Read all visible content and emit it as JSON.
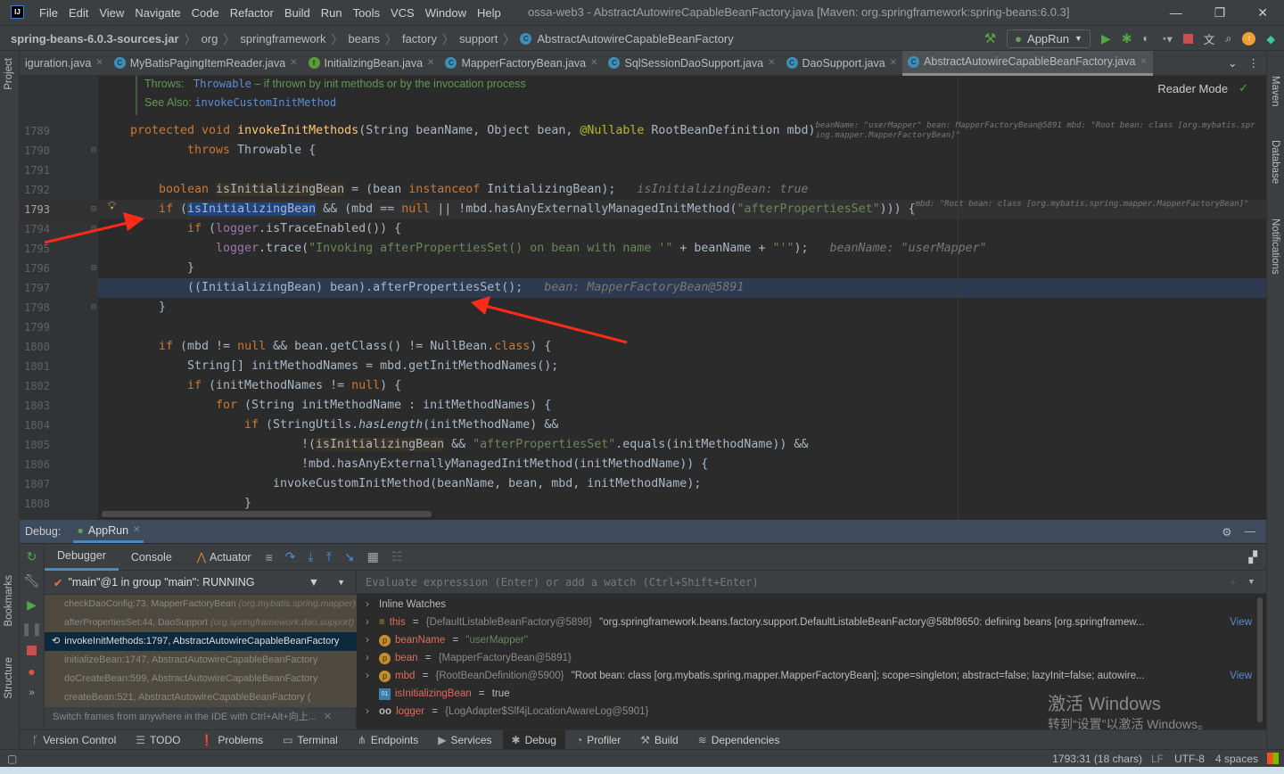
{
  "app": {
    "logo": "IJ",
    "menu": [
      "File",
      "Edit",
      "View",
      "Navigate",
      "Code",
      "Refactor",
      "Build",
      "Run",
      "Tools",
      "VCS",
      "Window",
      "Help"
    ],
    "title": "ossa-web3 - AbstractAutowireCapableBeanFactory.java [Maven: org.springframework:spring-beans:6.0.3]"
  },
  "breadcrumbs": [
    "spring-beans-6.0.3-sources.jar",
    "org",
    "springframework",
    "beans",
    "factory",
    "support",
    "AbstractAutowireCapableBeanFactory"
  ],
  "toolbar": {
    "run_config": "AppRun"
  },
  "tabs": [
    {
      "label": "iguration.java",
      "icon": "class",
      "active": false
    },
    {
      "label": "MyBatisPagingItemReader.java",
      "icon": "class",
      "active": false
    },
    {
      "label": "InitializingBean.java",
      "icon": "interface",
      "active": false
    },
    {
      "label": "MapperFactoryBean.java",
      "icon": "class",
      "active": false
    },
    {
      "label": "SqlSessionDaoSupport.java",
      "icon": "class",
      "active": false
    },
    {
      "label": "DaoSupport.java",
      "icon": "class",
      "active": false
    },
    {
      "label": "AbstractAutowireCapableBeanFactory.java",
      "icon": "class",
      "active": true
    }
  ],
  "side_left": [
    "Project",
    "Bookmarks",
    "Structure"
  ],
  "side_right": [
    "Maven",
    "Database",
    "Notifications"
  ],
  "editor": {
    "reader_mode": "Reader Mode",
    "doc": {
      "throws_label": "Throws:",
      "throws_type": "Throwable",
      "throws_text": " – if thrown by init methods or by the invocation process",
      "see_label": "See Also:",
      "see_link": "invokeCustomInitMethod"
    },
    "lines": [
      {
        "n": "1789",
        "indent": 0,
        "tokens": [
          {
            "t": "kw",
            "s": "protected void "
          },
          {
            "t": "fn",
            "s": "invokeInitMethods"
          },
          {
            "t": "p",
            "s": "(String beanName, Object bean, "
          },
          {
            "t": "ann",
            "s": "@Nullable"
          },
          {
            "t": "p",
            "s": " RootBeanDefinition mbd)"
          },
          {
            "t": "hint",
            "s": "   beanName: \"userMapper\"    bean: MapperFactoryBean@5891    mbd: \"Root bean: class [org.mybatis.spring.mapper.MapperFactoryBean]\""
          }
        ]
      },
      {
        "n": "1790",
        "indent": 8,
        "tokens": [
          {
            "t": "kw",
            "s": "throws"
          },
          {
            "t": "p",
            "s": " Throwable {"
          }
        ]
      },
      {
        "n": "1791",
        "indent": 0,
        "tokens": []
      },
      {
        "n": "1792",
        "indent": 4,
        "tokens": [
          {
            "t": "kw",
            "s": "boolean "
          },
          {
            "t": "var",
            "s": "isInitializingBean"
          },
          {
            "t": "p",
            "s": " = (bean "
          },
          {
            "t": "kw",
            "s": "instanceof"
          },
          {
            "t": "p",
            "s": " InitializingBean);"
          },
          {
            "t": "hint",
            "s": "   isInitializingBean: true"
          }
        ]
      },
      {
        "n": "1793",
        "indent": 4,
        "current": true,
        "tokens": [
          {
            "t": "kw",
            "s": "if"
          },
          {
            "t": "p",
            "s": " ("
          },
          {
            "t": "sel",
            "s": "isInitializingBean"
          },
          {
            "t": "p",
            "s": " && (mbd == "
          },
          {
            "t": "kw",
            "s": "null"
          },
          {
            "t": "p",
            "s": " || !mbd.hasAnyExternallyManagedInitMethod("
          },
          {
            "t": "str",
            "s": "\"afterPropertiesSet\""
          },
          {
            "t": "p",
            "s": "))) {"
          },
          {
            "t": "hint",
            "s": "   mbd: \"Root bean: class [org.mybatis.spring.mapper.MapperFactoryBean]\""
          }
        ]
      },
      {
        "n": "1794",
        "indent": 8,
        "tokens": [
          {
            "t": "kw",
            "s": "if"
          },
          {
            "t": "p",
            "s": " ("
          },
          {
            "t": "field",
            "s": "logger"
          },
          {
            "t": "p",
            "s": ".isTraceEnabled()) {"
          }
        ]
      },
      {
        "n": "1795",
        "indent": 12,
        "tokens": [
          {
            "t": "field",
            "s": "logger"
          },
          {
            "t": "p",
            "s": ".trace("
          },
          {
            "t": "str",
            "s": "\"Invoking afterPropertiesSet() on bean with name '\""
          },
          {
            "t": "p",
            "s": " + beanName + "
          },
          {
            "t": "str",
            "s": "\"'\""
          },
          {
            "t": "p",
            "s": ");"
          },
          {
            "t": "hint",
            "s": "   beanName: \"userMapper\""
          }
        ]
      },
      {
        "n": "1796",
        "indent": 8,
        "tokens": [
          {
            "t": "p",
            "s": "}"
          }
        ]
      },
      {
        "n": "1797",
        "indent": 8,
        "exec": true,
        "tokens": [
          {
            "t": "p",
            "s": "((InitializingBean) bean).afterPropertiesSet();"
          },
          {
            "t": "hint",
            "s": "   bean: MapperFactoryBean@5891"
          }
        ]
      },
      {
        "n": "1798",
        "indent": 4,
        "tokens": [
          {
            "t": "p",
            "s": "}"
          }
        ]
      },
      {
        "n": "1799",
        "indent": 0,
        "tokens": []
      },
      {
        "n": "1800",
        "indent": 4,
        "tokens": [
          {
            "t": "kw",
            "s": "if"
          },
          {
            "t": "p",
            "s": " (mbd != "
          },
          {
            "t": "kw",
            "s": "null"
          },
          {
            "t": "p",
            "s": " && bean.getClass() != NullBean."
          },
          {
            "t": "kw",
            "s": "class"
          },
          {
            "t": "p",
            "s": ") {"
          }
        ]
      },
      {
        "n": "1801",
        "indent": 8,
        "tokens": [
          {
            "t": "p",
            "s": "String[] initMethodNames = mbd.getInitMethodNames();"
          }
        ]
      },
      {
        "n": "1802",
        "indent": 8,
        "tokens": [
          {
            "t": "kw",
            "s": "if"
          },
          {
            "t": "p",
            "s": " (initMethodNames != "
          },
          {
            "t": "kw",
            "s": "null"
          },
          {
            "t": "p",
            "s": ") {"
          }
        ]
      },
      {
        "n": "1803",
        "indent": 12,
        "tokens": [
          {
            "t": "kw",
            "s": "for"
          },
          {
            "t": "p",
            "s": " (String initMethodName : initMethodNames) {"
          }
        ]
      },
      {
        "n": "1804",
        "indent": 16,
        "tokens": [
          {
            "t": "kw",
            "s": "if"
          },
          {
            "t": "p",
            "s": " (StringUtils."
          },
          {
            "t": "it",
            "s": "hasLength"
          },
          {
            "t": "p",
            "s": "(initMethodName) &&"
          }
        ]
      },
      {
        "n": "1805",
        "indent": 24,
        "tokens": [
          {
            "t": "p",
            "s": "!("
          },
          {
            "t": "var",
            "s": "isInitializingBean"
          },
          {
            "t": "p",
            "s": " && "
          },
          {
            "t": "str",
            "s": "\"afterPropertiesSet\""
          },
          {
            "t": "p",
            "s": ".equals(initMethodName)) &&"
          }
        ]
      },
      {
        "n": "1806",
        "indent": 24,
        "tokens": [
          {
            "t": "p",
            "s": "!mbd.hasAnyExternallyManagedInitMethod(initMethodName)) {"
          }
        ]
      },
      {
        "n": "1807",
        "indent": 20,
        "tokens": [
          {
            "t": "p",
            "s": "invokeCustomInitMethod(beanName, bean, mbd, initMethodName);"
          }
        ]
      },
      {
        "n": "1808",
        "indent": 16,
        "tokens": [
          {
            "t": "p",
            "s": "}"
          }
        ]
      }
    ]
  },
  "debug": {
    "label": "Debug:",
    "session": "AppRun",
    "subtabs": [
      "Debugger",
      "Console",
      "Actuator"
    ],
    "thread": "\"main\"@1 in group \"main\": RUNNING",
    "frames": [
      {
        "text": "checkDaoConfig:73, MapperFactoryBean ",
        "pkg": "(org.mybatis.spring.mapper)",
        "selected": false
      },
      {
        "text": "afterPropertiesSet:44, DaoSupport ",
        "pkg": "(org.springframework.dao.support)",
        "selected": false
      },
      {
        "text": "invokeInitMethods:1797, AbstractAutowireCapableBeanFactory",
        "pkg": "",
        "selected": true
      },
      {
        "text": "initializeBean:1747, AbstractAutowireCapableBeanFactory",
        "pkg": "",
        "selected": false
      },
      {
        "text": "doCreateBean:599, AbstractAutowireCapableBeanFactory",
        "pkg": "",
        "selected": false
      },
      {
        "text": "createBean:521, AbstractAutowireCapableBeanFactory (",
        "pkg": "",
        "selected": false
      }
    ],
    "frames_hint": "Switch frames from anywhere in the IDE with Ctrl+Alt+向上...",
    "eval_placeholder": "Evaluate expression (Enter) or add a watch (Ctrl+Shift+Enter)",
    "variables": [
      {
        "icon": "none",
        "name": "",
        "eq": "",
        "val": "",
        "plain": "Inline Watches",
        "view": ""
      },
      {
        "icon": "stack",
        "name": "this",
        "eq": " = ",
        "val": "{DefaultListableBeanFactory@5898}",
        "plain": " \"org.springframework.beans.factory.support.DefaultListableBeanFactory@58bf8650: defining beans [org.springframew...",
        "view": "View"
      },
      {
        "icon": "param",
        "name": "beanName",
        "eq": " = ",
        "val": "",
        "plain": "",
        "str": "\"userMapper\"",
        "view": ""
      },
      {
        "icon": "param",
        "name": "bean",
        "eq": " = ",
        "val": "{MapperFactoryBean@5891}",
        "plain": "",
        "view": ""
      },
      {
        "icon": "param",
        "name": "mbd",
        "eq": " = ",
        "val": "{RootBeanDefinition@5900}",
        "plain": " \"Root bean: class [org.mybatis.spring.mapper.MapperFactoryBean]; scope=singleton; abstract=false; lazyInit=false; autowire...",
        "view": "View"
      },
      {
        "icon": "bool",
        "name": "isInitializingBean",
        "eq": " = ",
        "val": "",
        "plain": "true",
        "view": ""
      },
      {
        "icon": "infinity",
        "name": "logger",
        "eq": " = ",
        "val": "{LogAdapter$Slf4jLocationAwareLog@5901}",
        "plain": "",
        "view": ""
      }
    ]
  },
  "watermark": {
    "line1": "激活 Windows",
    "line2": "转到“设置”以激活 Windows。"
  },
  "bottom_tools": [
    {
      "label": "Version Control",
      "icon": "branch"
    },
    {
      "label": "TODO",
      "icon": "list"
    },
    {
      "label": "Problems",
      "icon": "alert"
    },
    {
      "label": "Terminal",
      "icon": "terminal"
    },
    {
      "label": "Endpoints",
      "icon": "endpoints"
    },
    {
      "label": "Services",
      "icon": "services"
    },
    {
      "label": "Debug",
      "icon": "bug",
      "active": true
    },
    {
      "label": "Profiler",
      "icon": "profiler"
    },
    {
      "label": "Build",
      "icon": "hammer"
    },
    {
      "label": "Dependencies",
      "icon": "layers"
    }
  ],
  "status": {
    "position": "1793:31 (18 chars)",
    "line_sep": "LF",
    "encoding": "UTF-8",
    "indent": "4 spaces"
  },
  "colors": {
    "keyword": "#cc7832",
    "function": "#ffc66d",
    "string": "#6a8759",
    "field": "#9876aa",
    "annotation": "#bbb529",
    "exec_line": "#2d3a4f",
    "annotation_arrow": "#ff2a1a"
  }
}
